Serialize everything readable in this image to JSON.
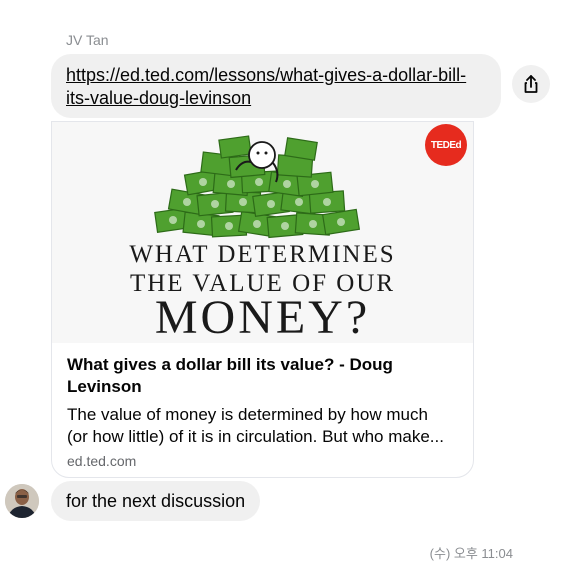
{
  "conversation": {
    "sender_name": "JV Tan",
    "link_message": "https://ed.ted.com/lessons/what-gives-a-dollar-bill-its-value-doug-levinson",
    "share_icon": "share-icon",
    "preview": {
      "badge": "TEDEd",
      "image_text_line1": "WHAT DETERMINES",
      "image_text_line2": "THE VALUE OF OUR",
      "image_text_line3": "MONEY?",
      "title": "What gives a dollar bill its value? - Doug Levinson",
      "description_line1": "The value of money is determined by how much",
      "description_line2": "(or how little) of it is in circulation. But who make...",
      "domain": "ed.ted.com"
    },
    "text_message": "for the next discussion",
    "timestamp": "(수) 오후 11:04",
    "colors": {
      "bubble": "#f0f0f0",
      "ted_red": "#e62b1e",
      "money_green": "#4fa02f"
    }
  }
}
